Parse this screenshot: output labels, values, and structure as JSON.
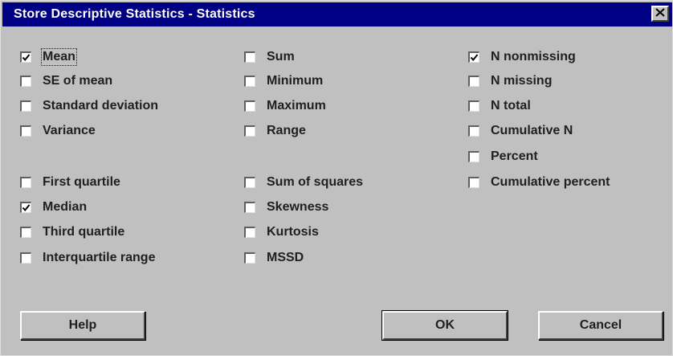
{
  "window": {
    "title": "Store Descriptive Statistics - Statistics"
  },
  "options": [
    {
      "id": "mean",
      "label": "Mean",
      "checked": true
    },
    {
      "id": "se-of-mean",
      "label": "SE of mean",
      "checked": false
    },
    {
      "id": "std-dev",
      "label": "Standard deviation",
      "checked": false
    },
    {
      "id": "variance",
      "label": "Variance",
      "checked": false
    },
    {
      "id": "first-quartile",
      "label": "First quartile",
      "checked": false
    },
    {
      "id": "median",
      "label": "Median",
      "checked": true
    },
    {
      "id": "third-quartile",
      "label": "Third quartile",
      "checked": false
    },
    {
      "id": "interquartile-range",
      "label": "Interquartile range",
      "checked": false
    },
    {
      "id": "sum",
      "label": "Sum",
      "checked": false
    },
    {
      "id": "minimum",
      "label": "Minimum",
      "checked": false
    },
    {
      "id": "maximum",
      "label": "Maximum",
      "checked": false
    },
    {
      "id": "range",
      "label": "Range",
      "checked": false
    },
    {
      "id": "sum-of-squares",
      "label": "Sum of squares",
      "checked": false
    },
    {
      "id": "skewness",
      "label": "Skewness",
      "checked": false
    },
    {
      "id": "kurtosis",
      "label": "Kurtosis",
      "checked": false
    },
    {
      "id": "mssd",
      "label": "MSSD",
      "checked": false
    },
    {
      "id": "n-nonmissing",
      "label": "N nonmissing",
      "checked": true
    },
    {
      "id": "n-missing",
      "label": "N missing",
      "checked": false
    },
    {
      "id": "n-total",
      "label": "N total",
      "checked": false
    },
    {
      "id": "cumulative-n",
      "label": "Cumulative N",
      "checked": false
    },
    {
      "id": "percent",
      "label": "Percent",
      "checked": false
    },
    {
      "id": "cumulative-percent",
      "label": "Cumulative percent",
      "checked": false
    }
  ],
  "buttons": {
    "help": "Help",
    "ok": "OK",
    "cancel": "Cancel"
  },
  "icons": {
    "close": "close-icon",
    "check": "checkmark-icon"
  },
  "colors": {
    "titlebar": "#000084",
    "face": "#c0c0c0"
  }
}
